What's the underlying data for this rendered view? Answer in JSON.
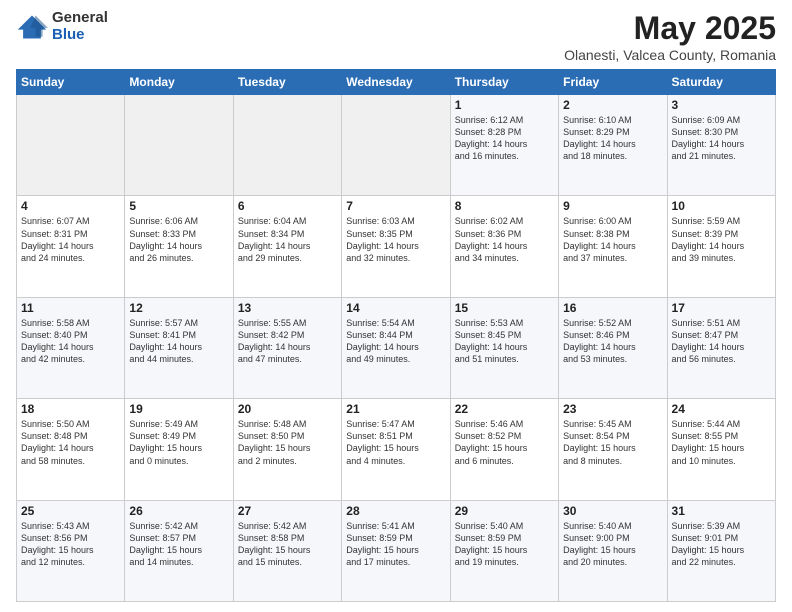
{
  "logo": {
    "general": "General",
    "blue": "Blue"
  },
  "title": "May 2025",
  "subtitle": "Olanesti, Valcea County, Romania",
  "days_header": [
    "Sunday",
    "Monday",
    "Tuesday",
    "Wednesday",
    "Thursday",
    "Friday",
    "Saturday"
  ],
  "weeks": [
    [
      {
        "day": "",
        "content": ""
      },
      {
        "day": "",
        "content": ""
      },
      {
        "day": "",
        "content": ""
      },
      {
        "day": "",
        "content": ""
      },
      {
        "day": "1",
        "content": "Sunrise: 6:12 AM\nSunset: 8:28 PM\nDaylight: 14 hours\nand 16 minutes."
      },
      {
        "day": "2",
        "content": "Sunrise: 6:10 AM\nSunset: 8:29 PM\nDaylight: 14 hours\nand 18 minutes."
      },
      {
        "day": "3",
        "content": "Sunrise: 6:09 AM\nSunset: 8:30 PM\nDaylight: 14 hours\nand 21 minutes."
      }
    ],
    [
      {
        "day": "4",
        "content": "Sunrise: 6:07 AM\nSunset: 8:31 PM\nDaylight: 14 hours\nand 24 minutes."
      },
      {
        "day": "5",
        "content": "Sunrise: 6:06 AM\nSunset: 8:33 PM\nDaylight: 14 hours\nand 26 minutes."
      },
      {
        "day": "6",
        "content": "Sunrise: 6:04 AM\nSunset: 8:34 PM\nDaylight: 14 hours\nand 29 minutes."
      },
      {
        "day": "7",
        "content": "Sunrise: 6:03 AM\nSunset: 8:35 PM\nDaylight: 14 hours\nand 32 minutes."
      },
      {
        "day": "8",
        "content": "Sunrise: 6:02 AM\nSunset: 8:36 PM\nDaylight: 14 hours\nand 34 minutes."
      },
      {
        "day": "9",
        "content": "Sunrise: 6:00 AM\nSunset: 8:38 PM\nDaylight: 14 hours\nand 37 minutes."
      },
      {
        "day": "10",
        "content": "Sunrise: 5:59 AM\nSunset: 8:39 PM\nDaylight: 14 hours\nand 39 minutes."
      }
    ],
    [
      {
        "day": "11",
        "content": "Sunrise: 5:58 AM\nSunset: 8:40 PM\nDaylight: 14 hours\nand 42 minutes."
      },
      {
        "day": "12",
        "content": "Sunrise: 5:57 AM\nSunset: 8:41 PM\nDaylight: 14 hours\nand 44 minutes."
      },
      {
        "day": "13",
        "content": "Sunrise: 5:55 AM\nSunset: 8:42 PM\nDaylight: 14 hours\nand 47 minutes."
      },
      {
        "day": "14",
        "content": "Sunrise: 5:54 AM\nSunset: 8:44 PM\nDaylight: 14 hours\nand 49 minutes."
      },
      {
        "day": "15",
        "content": "Sunrise: 5:53 AM\nSunset: 8:45 PM\nDaylight: 14 hours\nand 51 minutes."
      },
      {
        "day": "16",
        "content": "Sunrise: 5:52 AM\nSunset: 8:46 PM\nDaylight: 14 hours\nand 53 minutes."
      },
      {
        "day": "17",
        "content": "Sunrise: 5:51 AM\nSunset: 8:47 PM\nDaylight: 14 hours\nand 56 minutes."
      }
    ],
    [
      {
        "day": "18",
        "content": "Sunrise: 5:50 AM\nSunset: 8:48 PM\nDaylight: 14 hours\nand 58 minutes."
      },
      {
        "day": "19",
        "content": "Sunrise: 5:49 AM\nSunset: 8:49 PM\nDaylight: 15 hours\nand 0 minutes."
      },
      {
        "day": "20",
        "content": "Sunrise: 5:48 AM\nSunset: 8:50 PM\nDaylight: 15 hours\nand 2 minutes."
      },
      {
        "day": "21",
        "content": "Sunrise: 5:47 AM\nSunset: 8:51 PM\nDaylight: 15 hours\nand 4 minutes."
      },
      {
        "day": "22",
        "content": "Sunrise: 5:46 AM\nSunset: 8:52 PM\nDaylight: 15 hours\nand 6 minutes."
      },
      {
        "day": "23",
        "content": "Sunrise: 5:45 AM\nSunset: 8:54 PM\nDaylight: 15 hours\nand 8 minutes."
      },
      {
        "day": "24",
        "content": "Sunrise: 5:44 AM\nSunset: 8:55 PM\nDaylight: 15 hours\nand 10 minutes."
      }
    ],
    [
      {
        "day": "25",
        "content": "Sunrise: 5:43 AM\nSunset: 8:56 PM\nDaylight: 15 hours\nand 12 minutes."
      },
      {
        "day": "26",
        "content": "Sunrise: 5:42 AM\nSunset: 8:57 PM\nDaylight: 15 hours\nand 14 minutes."
      },
      {
        "day": "27",
        "content": "Sunrise: 5:42 AM\nSunset: 8:58 PM\nDaylight: 15 hours\nand 15 minutes."
      },
      {
        "day": "28",
        "content": "Sunrise: 5:41 AM\nSunset: 8:59 PM\nDaylight: 15 hours\nand 17 minutes."
      },
      {
        "day": "29",
        "content": "Sunrise: 5:40 AM\nSunset: 8:59 PM\nDaylight: 15 hours\nand 19 minutes."
      },
      {
        "day": "30",
        "content": "Sunrise: 5:40 AM\nSunset: 9:00 PM\nDaylight: 15 hours\nand 20 minutes."
      },
      {
        "day": "31",
        "content": "Sunrise: 5:39 AM\nSunset: 9:01 PM\nDaylight: 15 hours\nand 22 minutes."
      }
    ]
  ]
}
